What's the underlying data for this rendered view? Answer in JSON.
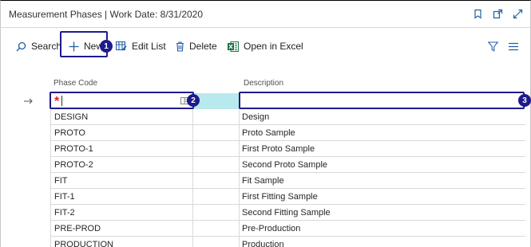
{
  "window": {
    "title": "Measurement Phases | Work Date: 8/31/2020",
    "icons": [
      "bookmark-icon",
      "open-in-new-window-icon",
      "expand-icon"
    ]
  },
  "toolbar": {
    "search_label": "Search",
    "new_label": "New",
    "edit_list_label": "Edit List",
    "delete_label": "Delete",
    "open_excel_label": "Open in Excel"
  },
  "table": {
    "columns": [
      "Phase Code",
      "Description"
    ],
    "new_row": {
      "phase_code": "",
      "description": ""
    },
    "rows": [
      {
        "phase_code": "DESIGN",
        "description": "Design"
      },
      {
        "phase_code": "PROTO",
        "description": "Proto Sample"
      },
      {
        "phase_code": "PROTO-1",
        "description": "First Proto Sample"
      },
      {
        "phase_code": "PROTO-2",
        "description": "Second Proto Sample"
      },
      {
        "phase_code": "FIT",
        "description": "Fit Sample"
      },
      {
        "phase_code": "FIT-1",
        "description": "First Fitting Sample"
      },
      {
        "phase_code": "FIT-2",
        "description": "Second Fitting Sample"
      },
      {
        "phase_code": "PRE-PROD",
        "description": "Pre-Production"
      },
      {
        "phase_code": "PRODUCTION",
        "description": "Production"
      }
    ]
  },
  "callouts": [
    "1",
    "2",
    "3"
  ],
  "colors": {
    "accent": "#1d1b8c",
    "selected_cell": "#b8e9ec",
    "required": "#e01e1e",
    "excel_green": "#1e7145"
  }
}
